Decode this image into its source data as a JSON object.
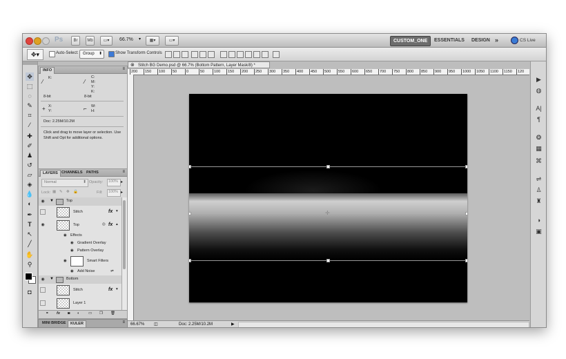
{
  "app": {
    "logo": "Ps",
    "zoom": "66.7%",
    "workspaces": [
      "CUSTOM_ONE",
      "ESSENTIALS",
      "DESIGN"
    ],
    "more": "»",
    "cs_live": "CS Live"
  },
  "options_bar": {
    "auto_select_label": "Auto-Select:",
    "auto_select_value": "Group",
    "show_transform_label": "Show Transform Controls"
  },
  "info_panel": {
    "tab": "INFO",
    "k_label": "K:",
    "cmyk_labels": [
      "C:",
      "M:",
      "Y:",
      "K:"
    ],
    "bit_left": "8-bit",
    "bit_right": "8-bit",
    "x_label": "X:",
    "y_label": "Y:",
    "w_label": "W:",
    "h_label": "H:",
    "doc": "Doc: 2.25M/10.2M",
    "hint": "Click and drag to move layer or selection. Use Shift and Opt for additional options."
  },
  "layers_panel": {
    "tabs": [
      "LAYERS",
      "CHANNELS",
      "PATHS"
    ],
    "blend_mode": "Normal",
    "opacity_label": "Opacity:",
    "opacity_value": "100%",
    "lock_label": "Lock:",
    "fill_label": "Fill:",
    "fill_value": "100%",
    "rows": [
      {
        "name": "Top",
        "type": "group"
      },
      {
        "name": "Stitch",
        "type": "layer",
        "fx": "fx"
      },
      {
        "name": "Top",
        "type": "layer",
        "fx": "fx"
      },
      {
        "name": "Effects",
        "type": "effect-header"
      },
      {
        "name": "Gradient Overlay",
        "type": "effect"
      },
      {
        "name": "Pattern Overlay",
        "type": "effect"
      },
      {
        "name": "Smart Filters",
        "type": "smart"
      },
      {
        "name": "Add Noise",
        "type": "effect"
      },
      {
        "name": "Bottom",
        "type": "group"
      },
      {
        "name": "Stitch",
        "type": "layer",
        "fx": "fx"
      },
      {
        "name": "Layer 1",
        "type": "layer"
      }
    ]
  },
  "bottom_tabs": [
    "MINI BRIDGE",
    "KULER"
  ],
  "document": {
    "tab_title": "Stitch BG Demo.psd @ 66.7% (Bottom Pattern, Layer Mask/8) *",
    "ruler_marks": [
      "200",
      "150",
      "100",
      "50",
      "0",
      "50",
      "100",
      "150",
      "200",
      "250",
      "300",
      "350",
      "400",
      "450",
      "500",
      "550",
      "600",
      "650",
      "700",
      "750",
      "800",
      "850",
      "900",
      "950",
      "1000",
      "1050",
      "1100",
      "1150",
      "120"
    ],
    "status_zoom": "66.67%",
    "status_doc": "Doc: 2.25M/10.2M"
  }
}
